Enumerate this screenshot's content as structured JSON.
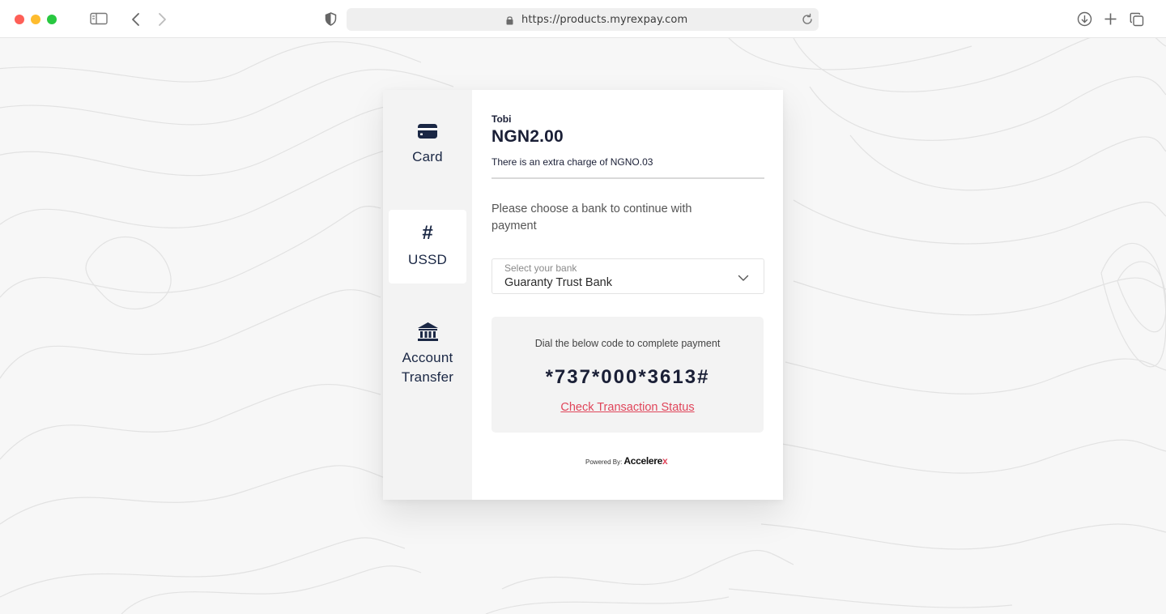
{
  "browser": {
    "url": "https://products.myrexpay.com"
  },
  "checkout": {
    "payment_methods": [
      {
        "label": "Card",
        "icon": "credit-card-icon",
        "active": false
      },
      {
        "label": "USSD",
        "icon": "hash-icon",
        "glyph": "#",
        "active": true
      },
      {
        "label": "Account Transfer",
        "icon": "bank-icon",
        "active": false
      }
    ],
    "merchant_name": "Tobi",
    "amount": "NGN2.00",
    "extra_charge": "There is an extra charge of NGNO.03",
    "instruction": "Please choose a bank to continue with payment",
    "bank_select": {
      "label": "Select your bank",
      "value": "Guaranty Trust Bank"
    },
    "ussd": {
      "dial_text": "Dial the below code to complete payment",
      "code": "*737*000*3613#",
      "status_link": "Check Transaction Status"
    },
    "powered_by": {
      "prefix": "Powered By:",
      "brand": "Accelere",
      "brand_suffix": "x"
    }
  },
  "colors": {
    "accent_red": "#e0455a",
    "navy": "#1a2744",
    "sidebar_bg": "#f3f3f3"
  }
}
